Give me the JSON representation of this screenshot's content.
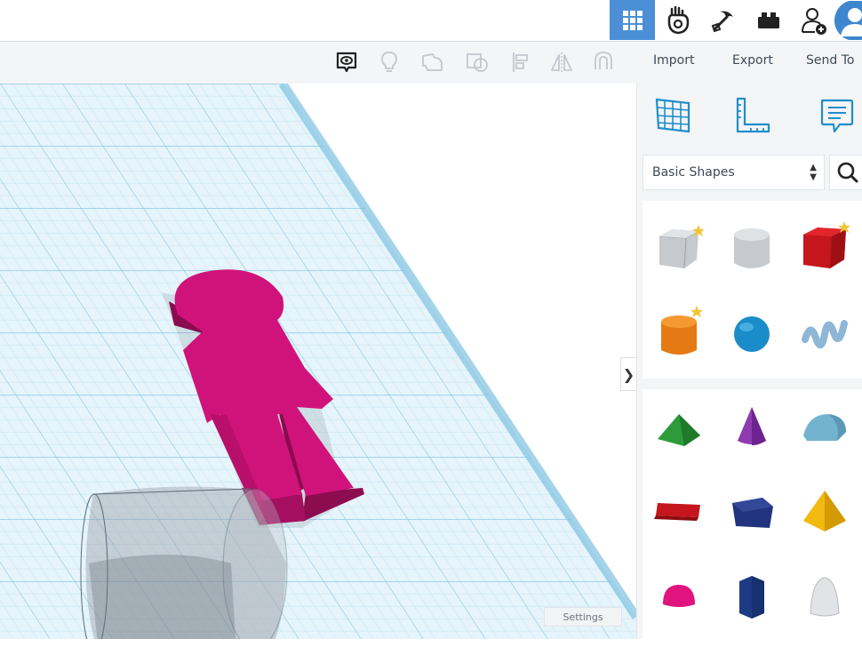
{
  "colors": {
    "accent": "#4b8fd6",
    "grid_line": "#9fd3ea",
    "person_shape": "#d0137a",
    "cylinder_hole": "#b8bcc2"
  },
  "header": {
    "icons": [
      "grid-view-icon",
      "tinkercad-hand-icon",
      "pickaxe-icon",
      "brick-icon",
      "add-user-icon",
      "avatar"
    ]
  },
  "toolbar": {
    "icons": [
      "view-icon",
      "lightbulb-icon",
      "group-icon",
      "ungroup-icon",
      "align-icon",
      "mirror-icon",
      "magnet-icon"
    ],
    "import_label": "Import",
    "export_label": "Export",
    "send_to_label": "Send To"
  },
  "panel": {
    "tabs": [
      "workplane-icon",
      "ruler-icon",
      "notes-icon"
    ],
    "shape_library": {
      "selected": "Basic Shapes"
    },
    "shapes": [
      {
        "name": "box-hole",
        "featured": true
      },
      {
        "name": "cylinder-hole",
        "featured": false
      },
      {
        "name": "box",
        "featured": true
      },
      {
        "name": "cylinder",
        "featured": true
      },
      {
        "name": "sphere",
        "featured": false
      },
      {
        "name": "scribble",
        "featured": false
      },
      {
        "name": "roof",
        "featured": false
      },
      {
        "name": "cone",
        "featured": false
      },
      {
        "name": "round-roof",
        "featured": false
      },
      {
        "name": "text",
        "featured": false
      },
      {
        "name": "wedge",
        "featured": false
      },
      {
        "name": "pyramid",
        "featured": false
      },
      {
        "name": "half-sphere",
        "featured": false
      },
      {
        "name": "polygon",
        "featured": false
      },
      {
        "name": "paraboloid",
        "featured": false
      }
    ]
  },
  "viewport": {
    "settings_label": "Settings",
    "collapse_glyph": "❯"
  }
}
